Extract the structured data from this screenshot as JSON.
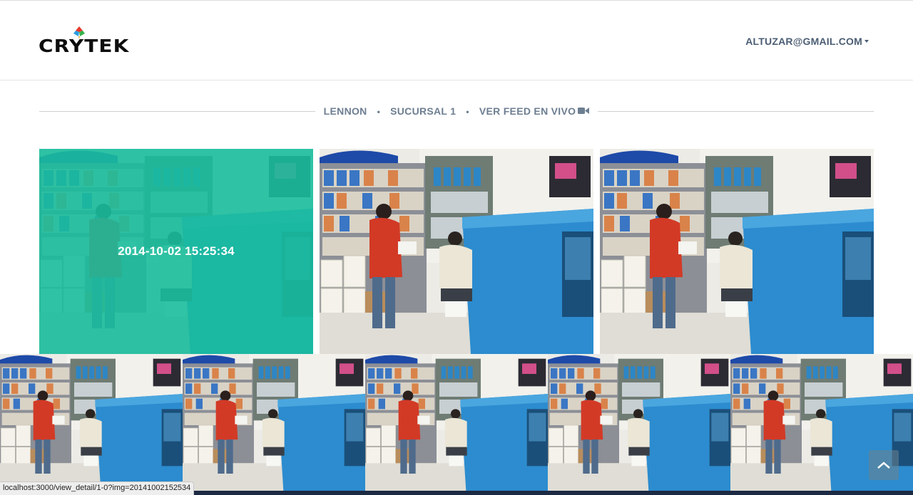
{
  "header": {
    "logo_text": "CRYTEK",
    "user_email": "ALTUZAR@GMAIL.COM"
  },
  "breadcrumb": {
    "items": [
      "LENNON",
      "SUCURSAL 1",
      "VER FEED EN VIVO"
    ],
    "separator": "•"
  },
  "gallery": {
    "selected_timestamp": "2014-10-02 15:25:34",
    "overlay_color": "#1abc9c"
  },
  "status_bar": {
    "url": "localhost:3000/view_detail/1-0?img=20141002152534"
  },
  "icons": {
    "video": "video-camera-icon",
    "caret": "caret-down-icon",
    "scroll_top": "chevron-up-icon"
  },
  "colors": {
    "nav_text": "#4b5d73",
    "crumb_text": "#6d7e91",
    "accent": "#1abc9c"
  }
}
